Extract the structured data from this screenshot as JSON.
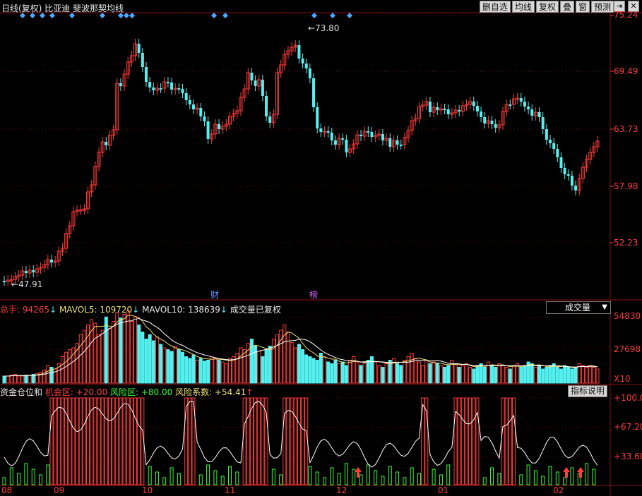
{
  "header": {
    "title": "日线(复权) 比亚迪 斐波那契均线",
    "toolbar": [
      "删自选",
      "均线",
      "复权",
      "叠",
      "窗",
      "预测"
    ],
    "pin_icon": "pin-icon",
    "close_icon": "close-icon"
  },
  "price_axis": {
    "ticks": [
      "75.24",
      "69.49",
      "63.73",
      "57.98",
      "52.23"
    ]
  },
  "price_annotations": {
    "high_label": "73.80",
    "low_label": "47.91",
    "event_cai": "财",
    "event_bang": "榜"
  },
  "volume_panel": {
    "total": "总手: 94265",
    "mavol5": "MAVOL5: 109720",
    "mavol10": "MAVOL10: 138639",
    "note": "成交量已复权",
    "dropdown_label": "成交量",
    "axis_ticks": [
      "54830",
      "27698",
      "X10"
    ]
  },
  "indicator_panel": {
    "name": "资金仓位和",
    "opportunity": "机会区: +20.00",
    "risk": "风险区: +80.00",
    "coef": "风险系数: +54.41",
    "help_button": "指标说明",
    "axis_ticks": [
      "+100.0",
      "+67.20",
      "+33.60"
    ]
  },
  "x_axis": {
    "labels": [
      "08",
      "09",
      "10",
      "11",
      "12",
      "01",
      "02"
    ]
  },
  "colors": {
    "up": "#ff3b3b",
    "down": "#54f0f0",
    "grid": "#8a1111",
    "yellow": "#f0e070",
    "green": "#33ff33"
  }
}
